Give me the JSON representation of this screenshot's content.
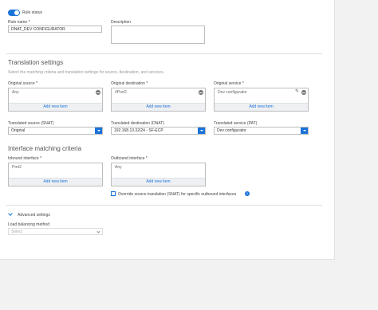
{
  "rule_status": {
    "label": "Rule status",
    "on": true
  },
  "rule_name": {
    "label": "Rule name *",
    "value": "DNAT_DEV CONFIGURATOR"
  },
  "description": {
    "label": "Description",
    "value": ""
  },
  "translation": {
    "title": "Translation settings",
    "subtitle": "Select the matching criteria and translation settings for source, destination, and services.",
    "original_source": {
      "label": "Original source *",
      "items": [
        "Any"
      ],
      "add_label": "Add new item"
    },
    "original_destination": {
      "label": "Original destination *",
      "items": [
        "#Port2"
      ],
      "add_label": "Add new item"
    },
    "original_service": {
      "label": "Original service *",
      "items": [
        "Dev configurator"
      ],
      "add_label": "Add new item"
    },
    "translated_source": {
      "label": "Translated source (SNAT)",
      "value": "Original"
    },
    "translated_destination": {
      "label": "Translated destination (DNAT)",
      "value": "192.168.13.32/24 - SF-ECP"
    },
    "translated_service": {
      "label": "Translated service (PAT)",
      "value": "Dev configurator"
    }
  },
  "interface": {
    "title": "Interface matching criteria",
    "inbound": {
      "label": "Inbound interface *",
      "items": [
        "Port2"
      ],
      "add_label": "Add new item"
    },
    "outbound": {
      "label": "Outbound interface *",
      "items": [
        "Any"
      ],
      "add_label": "Add new item"
    },
    "override_label": "Override source translation (SNAT) for specific outbound interfaces"
  },
  "advanced": {
    "label": "Advanced settings",
    "lb_label": "Load balancing method",
    "lb_value": "Select"
  },
  "colors": {
    "accent": "#1a73d9"
  }
}
